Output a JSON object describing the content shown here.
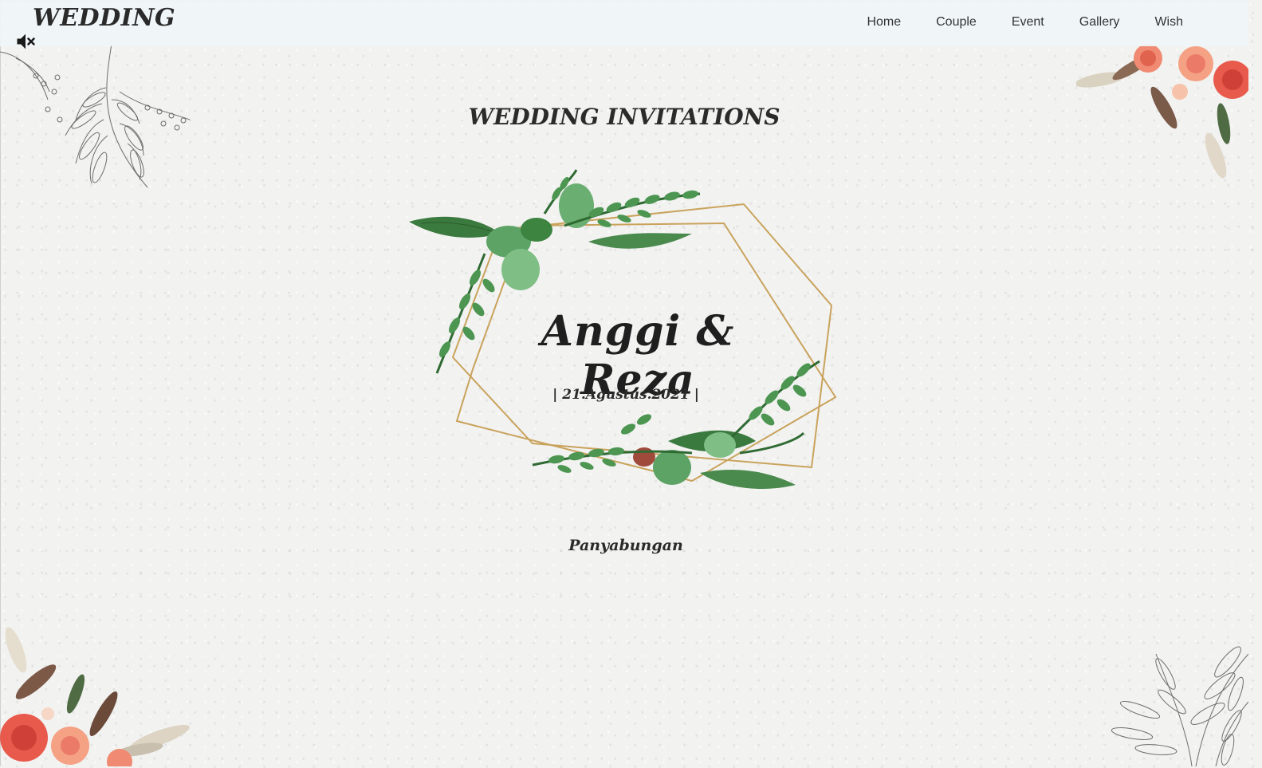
{
  "header": {
    "brand": "WEDDING",
    "nav": [
      "Home",
      "Couple",
      "Event",
      "Gallery",
      "Wish"
    ]
  },
  "audio": {
    "icon": "speaker-muted-icon"
  },
  "hero": {
    "title": "WEDDING INVITATIONS",
    "couple": "Anggi & Reza",
    "date": "| 21.Agustus.2021 |",
    "location": "Panyabungan"
  },
  "colors": {
    "background": "#f2f2f1",
    "navbar": "#f0f6f8",
    "text": "#2a2a2a",
    "gold": "#c9a35c",
    "leaf": "#3e8a45",
    "rose": "#ec7a68"
  }
}
